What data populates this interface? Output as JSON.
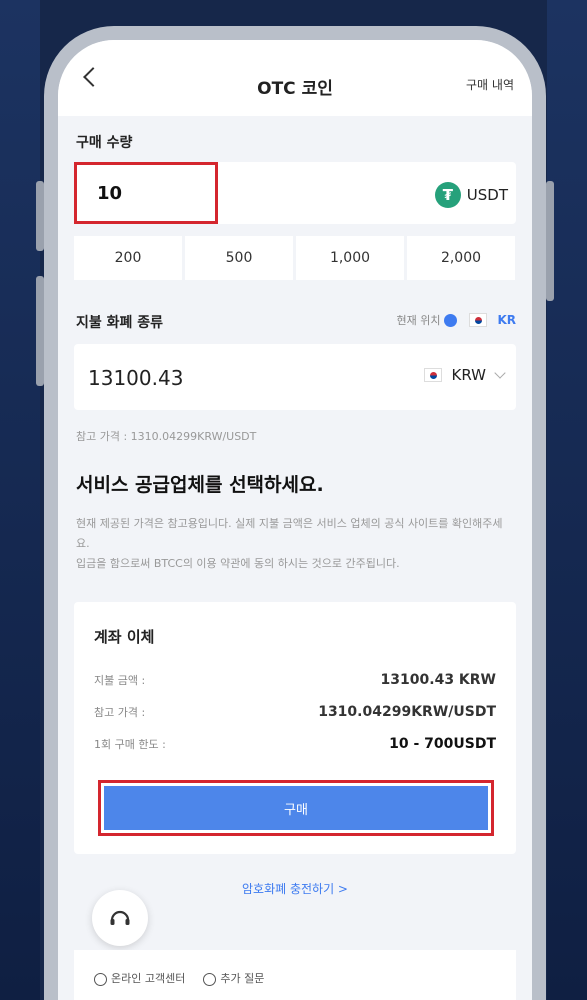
{
  "header": {
    "back": "back",
    "title": "OTC 코인",
    "history_link": "구매 내역"
  },
  "purchase": {
    "label": "구매 수량",
    "amount": "10",
    "currency": "USDT",
    "presets": [
      "200",
      "500",
      "1,000",
      "2,000"
    ]
  },
  "payment": {
    "label": "지불 화폐 종류",
    "location_label": "현재 위치",
    "region": "KR",
    "amount": "13100.43",
    "currency": "KRW",
    "reference": "참고 가격 : 1310.04299KRW/USDT"
  },
  "provider": {
    "heading": "서비스 공급업체를 선택하세요.",
    "notice_1": "현재 제공된 가격은 참고용입니다. 실제 지불 금액은 서비스 업체의 공식 사이트를 확인해주세요.",
    "notice_2": "입금을 함으로써 BTCC의 이용 약관에 동의 하시는 것으로 간주됩니다."
  },
  "bank_transfer": {
    "title": "계좌 이체",
    "rows": [
      {
        "key": "지불 금액 :",
        "value": "13100.43 KRW"
      },
      {
        "key": "참고 가격 :",
        "value": "1310.04299KRW/USDT"
      },
      {
        "key": "1회 구매 한도 :",
        "value": "10 - 700USDT"
      }
    ],
    "buy_label": "구매"
  },
  "charge_link": "암호화폐 충전하기  >",
  "footer": {
    "support": "온라인 고객센터",
    "faq": "추가 질문"
  },
  "colors": {
    "primary": "#4d86ea",
    "highlight": "#d4262e",
    "tether": "#26a17b"
  }
}
